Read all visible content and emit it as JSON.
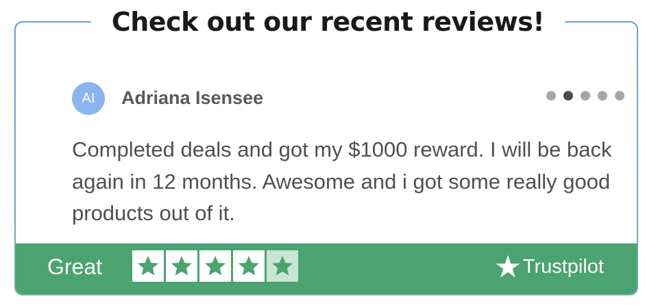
{
  "heading": "Check out our recent reviews!",
  "review": {
    "avatar_initials": "AI",
    "reviewer_name": "Adriana Isensee",
    "text": "Completed deals and got my $1000 reward. I will be back again in 12 months. Awesome and i got some really good products out of it.",
    "carousel": {
      "total": 5,
      "active_index": 1
    }
  },
  "footer": {
    "rating_label": "Great",
    "rating_stars": 4.5,
    "rating_max": 5,
    "brand": "Trustpilot"
  },
  "colors": {
    "footer_green": "#4aa370",
    "star_green": "#4aa370",
    "avatar_blue": "#8ab4f0",
    "dot_active": "#4d4d4d",
    "dot_inactive": "#a6a6a6"
  }
}
